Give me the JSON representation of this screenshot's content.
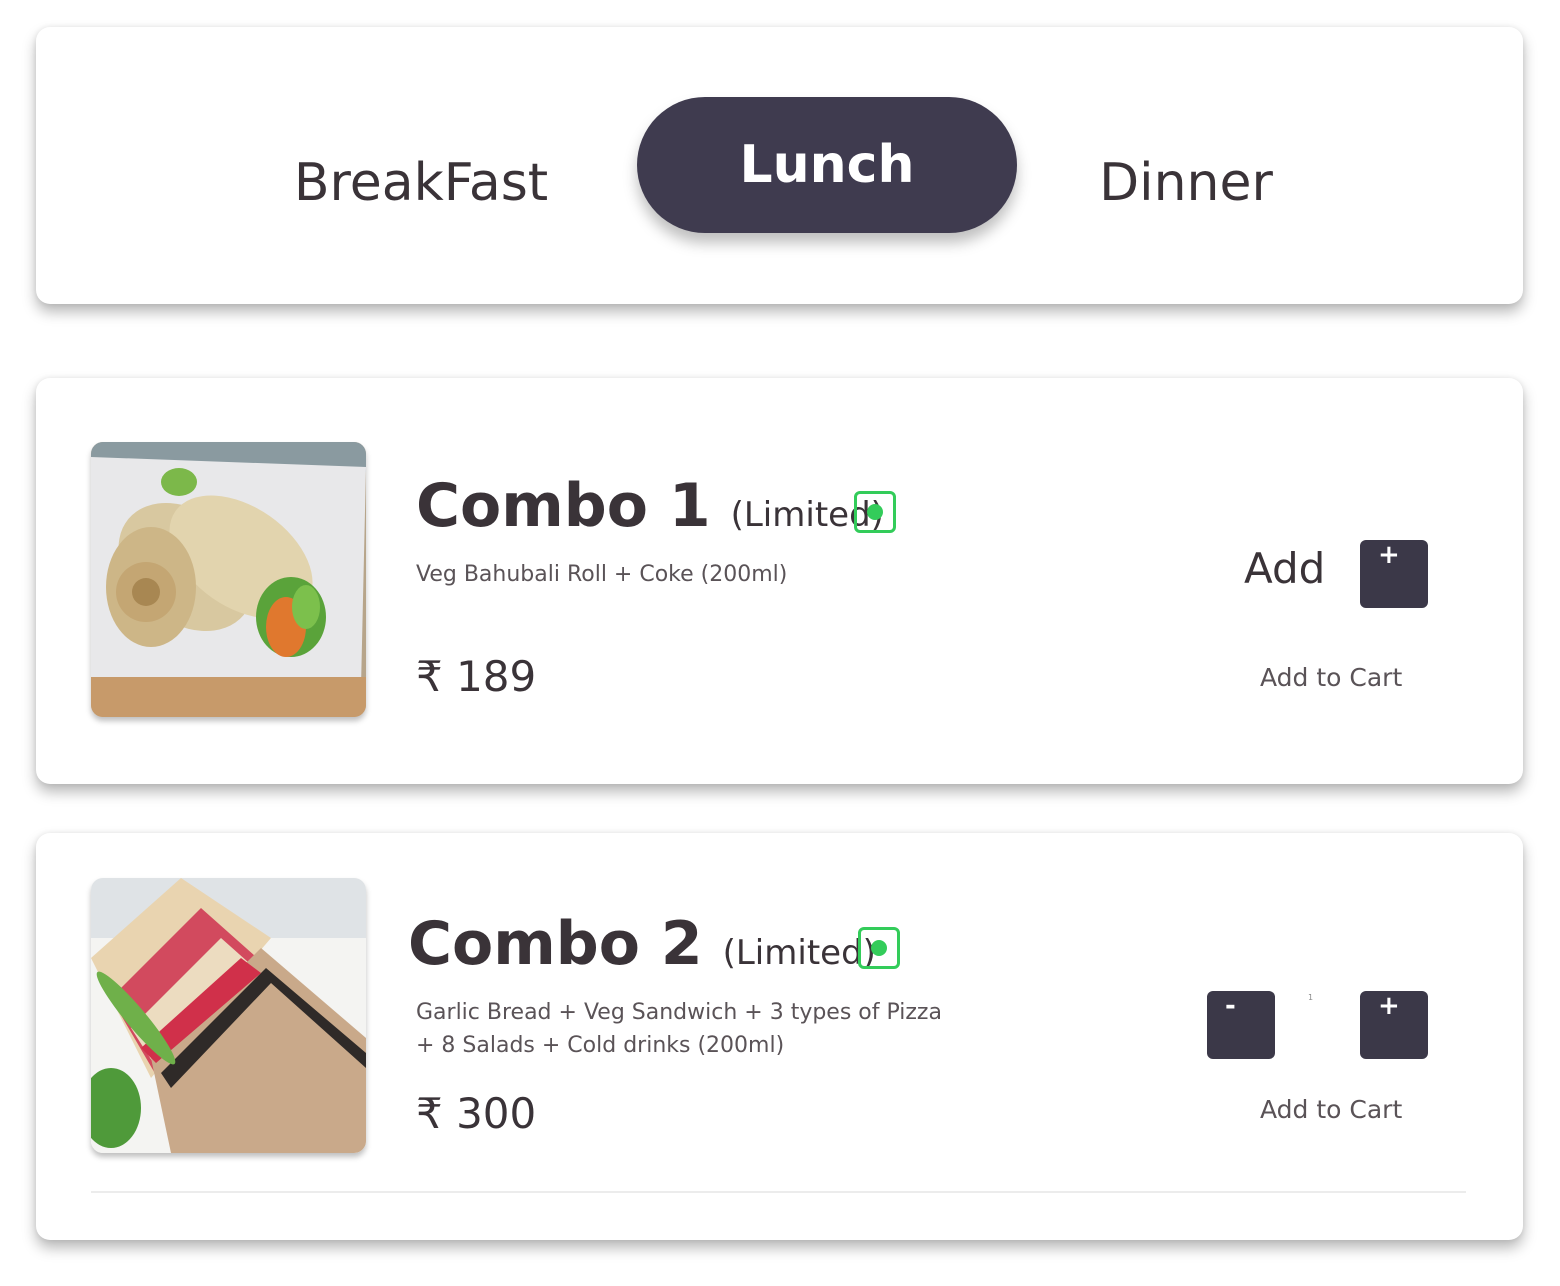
{
  "tabs": {
    "breakfast": "BreakFast",
    "lunch": "Lunch",
    "dinner": "Dinner",
    "active": "Lunch"
  },
  "colors": {
    "active_tab": "#3f3b4f",
    "button": "#3b3848",
    "veg": "#33cc5a"
  },
  "items": [
    {
      "title": "Combo 1",
      "badge": "(Limited)",
      "veg_icon": "veg-indicator-icon",
      "description": "Veg Bahubali Roll + Coke (200ml)",
      "price": "₹ 189",
      "add_label": "Add",
      "plus_label": "+",
      "cart_label": "Add to Cart"
    },
    {
      "title": "Combo 2",
      "badge": "(Limited)",
      "veg_icon": "veg-indicator-icon",
      "description_line1": "Garlic Bread + Veg Sandwich + 3 types of Pizza",
      "description_line2": "+ 8 Salads + Cold drinks (200ml)",
      "price": "₹ 300",
      "minus_label": "-",
      "quantity": "1",
      "plus_label": "+",
      "cart_label": "Add to Cart"
    }
  ]
}
